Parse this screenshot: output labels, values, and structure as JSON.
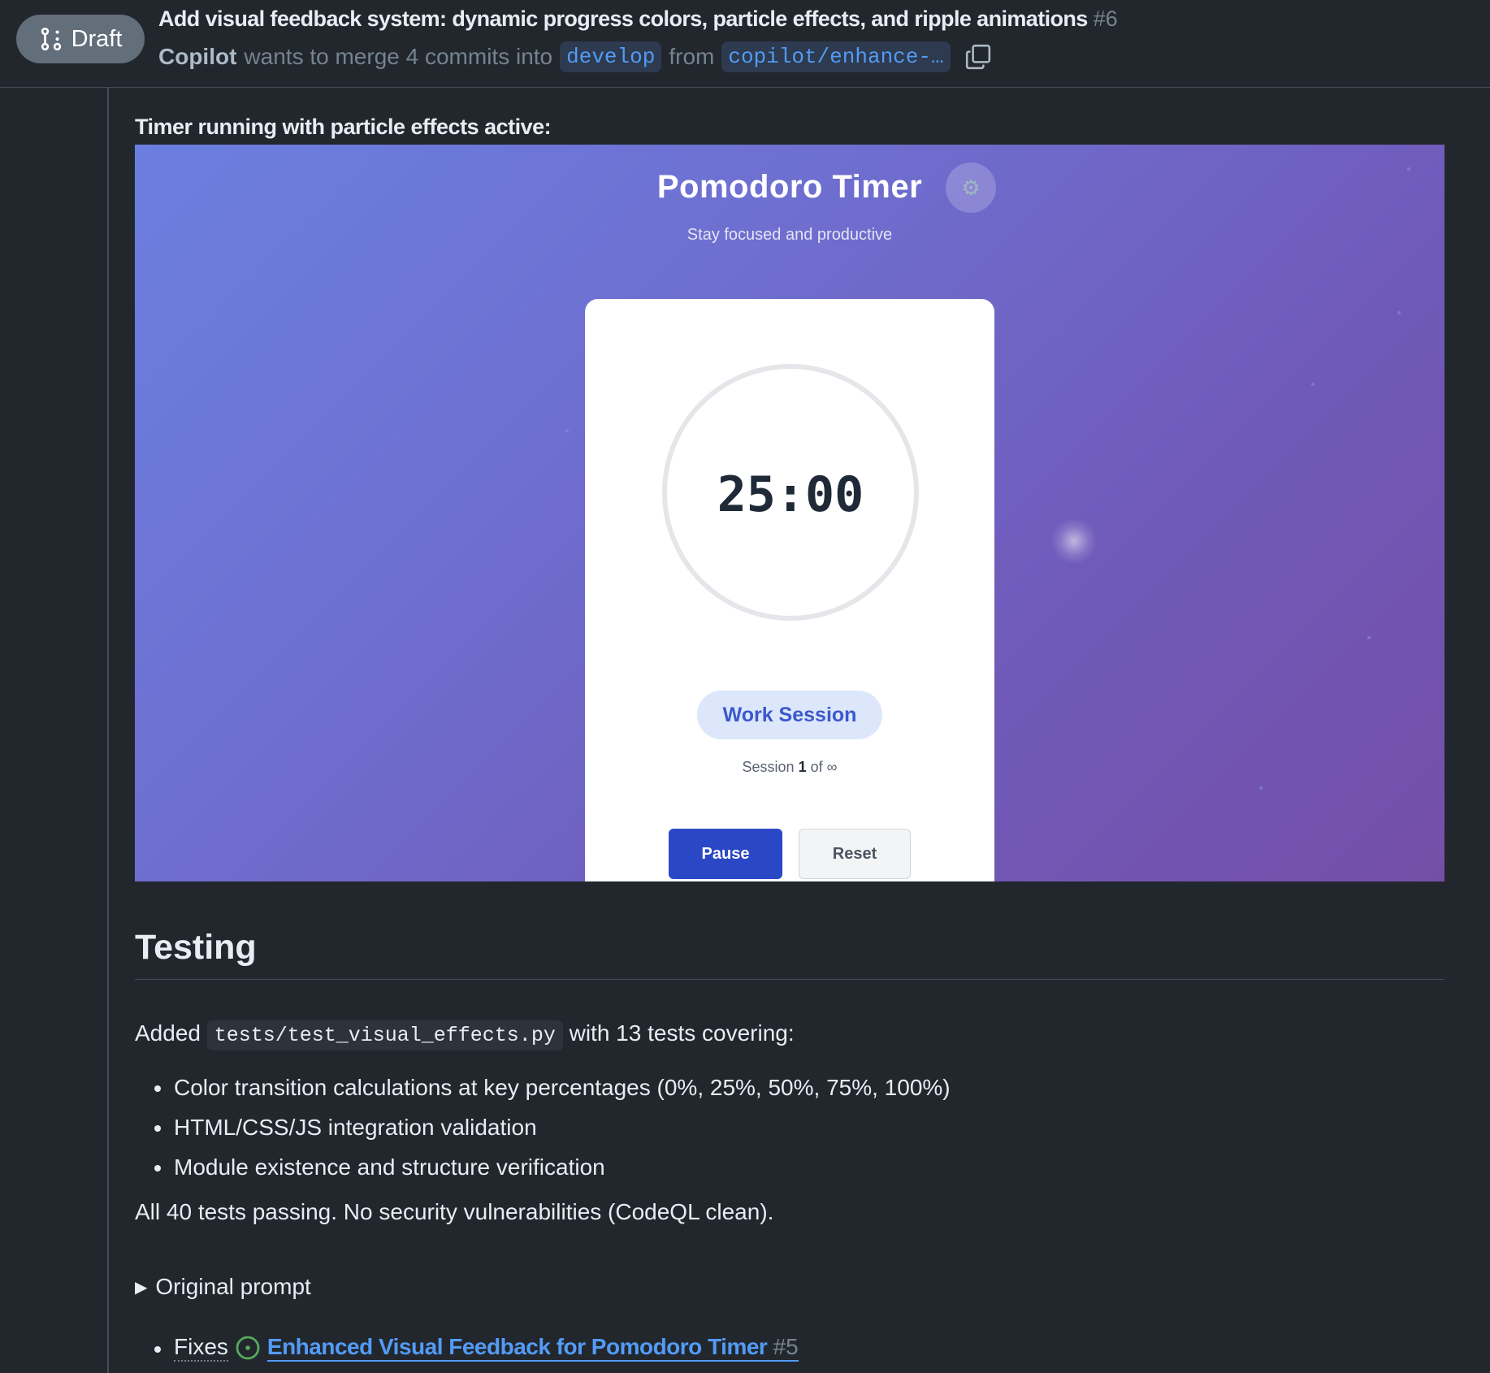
{
  "pr": {
    "badge_label": "Draft",
    "title": "Add visual feedback system: dynamic progress colors, particle effects, and ripple animations",
    "number": "#6",
    "author": "Copilot",
    "merge_text": "wants to merge 4 commits into",
    "base_branch": "develop",
    "from_text": "from",
    "head_branch": "copilot/enhance-…"
  },
  "body": {
    "caption": "Timer running with particle effects active:",
    "screenshot": {
      "app_title": "Pomodoro Timer",
      "settings_icon": "gear-icon",
      "subtitle": "Stay focused and productive",
      "time": "25:00",
      "session_type": "Work Session",
      "session_prefix": "Session",
      "session_number": "1",
      "session_suffix": "of ∞",
      "pause_label": "Pause",
      "reset_label": "Reset"
    },
    "testing_heading": "Testing",
    "added_prefix": "Added",
    "added_code": "tests/test_visual_effects.py",
    "added_suffix": "with 13 tests covering:",
    "bullets": [
      "Color transition calculations at key percentages (0%, 25%, 50%, 75%, 100%)",
      "HTML/CSS/JS integration validation",
      "Module existence and structure verification"
    ],
    "summary": "All 40 tests passing. No security vulnerabilities (CodeQL clean).",
    "details_label": "Original prompt",
    "fixes_word": "Fixes",
    "issue_title": "Enhanced Visual Feedback for Pomodoro Timer",
    "issue_number": "#5"
  },
  "colors": {
    "page_bg": "#22272e",
    "draft_badge": "#636e7b",
    "link": "#539bf5",
    "open_issue": "#57ab5a",
    "pause_button": "#2a48c6"
  }
}
